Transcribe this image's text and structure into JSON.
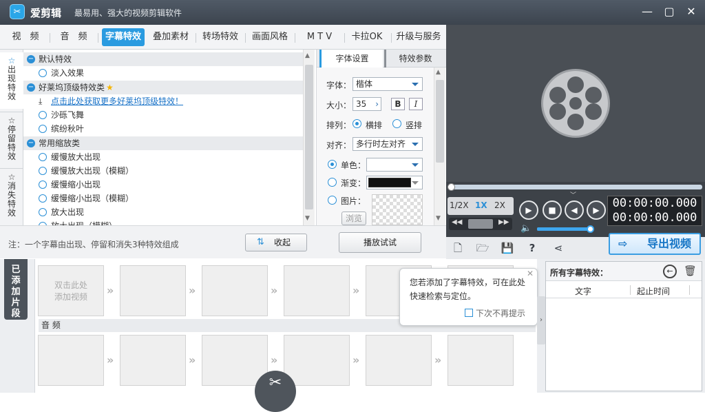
{
  "app": {
    "title": "爱剪辑",
    "slogan": "最易用、强大的视频剪辑软件"
  },
  "window": {
    "minimize": "—",
    "maximize": "▢",
    "close": "✕"
  },
  "tabs": [
    "视　频",
    "音　频",
    "字幕特效",
    "叠加素材",
    "转场特效",
    "画面风格",
    "M T V",
    "卡拉OK",
    "升级与服务"
  ],
  "side_tabs": [
    "出现特效",
    "停留特效",
    "消失特效"
  ],
  "effects": {
    "cat1": "默认特效",
    "item1": "淡入效果",
    "cat2": "好莱坞顶级特效类",
    "download_link": "点击此处获取更多好莱坞顶级特效！",
    "item2": "沙砾飞舞",
    "item3": "缤纷秋叶",
    "cat3": "常用缩放类",
    "item4": "缓慢放大出现",
    "item5": "缓慢放大出现（模糊）",
    "item6": "缓慢缩小出现",
    "item7": "缓慢缩小出现（模糊）",
    "item8": "放大出现",
    "item9": "放大出现（模糊）"
  },
  "settings": {
    "tab_font": "字体设置",
    "tab_params": "特效参数",
    "font_label": "字体：",
    "font_value": "楷体",
    "size_label": "大小：",
    "size_value": "35",
    "bold": "B",
    "italic": "I",
    "arrange_label": "排列：",
    "horizontal": "横排",
    "vertical": "竖排",
    "align_label": "对齐：",
    "align_value": "多行时左对齐",
    "solid_color": "单色：",
    "gradient": "渐变：",
    "image": "图片：",
    "browse": "浏览"
  },
  "footer": {
    "note": "注：一个字幕由出现、停留和消失3种特效组成",
    "collapse": "收起",
    "preview_btn": "播放试试"
  },
  "player": {
    "speed_half": "1/2X",
    "speed_1x": "1X",
    "speed_2x": "2X",
    "time1": "00:00:00.000",
    "time2": "00:00:00.000",
    "export": "导出视频",
    "volume_fraction": 0.95
  },
  "timeline": {
    "added_tab": "已添加片段",
    "add_video": "双击此处\n添加视频",
    "audio_label": "音 频"
  },
  "tooltip": {
    "text": "您若添加了字幕特效，可在此处快速检索与定位。",
    "no_remind": "下次不再提示"
  },
  "subtitle_panel": {
    "title": "所有字幕特效：",
    "col_text": "文字",
    "col_time": "起止时间"
  },
  "colors": {
    "accent": "#2a9be0",
    "titlebar": "#454d57"
  }
}
